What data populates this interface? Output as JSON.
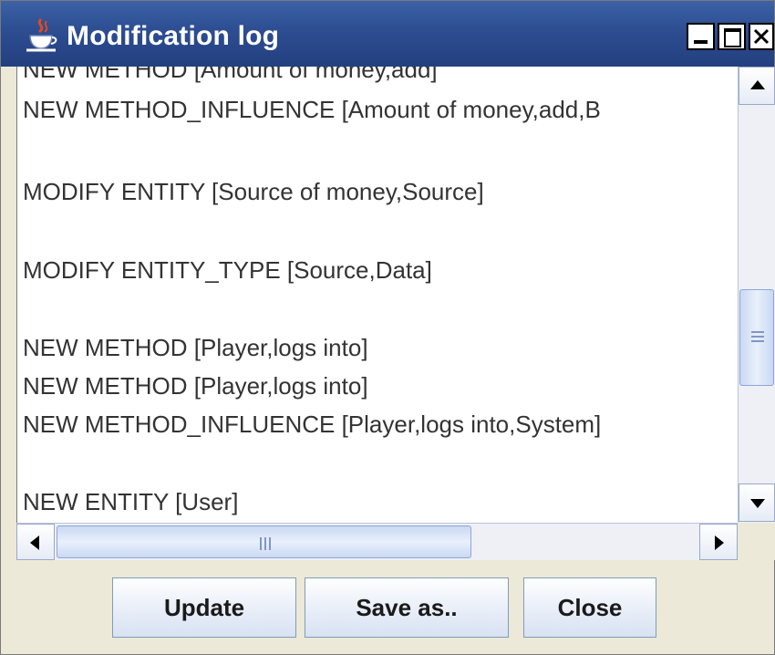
{
  "window": {
    "title": "Modification log",
    "controls": {
      "minimize": "minimize-icon",
      "maximize": "maximize-icon",
      "close": "close-icon"
    }
  },
  "log": {
    "lines": [
      "NEW METHOD [Amount of money,add]",
      "NEW METHOD_INFLUENCE [Amount of money,add,B",
      "",
      "MODIFY ENTITY [Source of money,Source]",
      "",
      "MODIFY ENTITY_TYPE [Source,Data]",
      "",
      "NEW METHOD [Player,logs into]",
      "NEW METHOD [Player,logs into]",
      "NEW METHOD_INFLUENCE [Player,logs into,System]",
      "",
      "NEW ENTITY [User]"
    ]
  },
  "buttons": {
    "update": "Update",
    "save_as": "Save as..",
    "close": "Close"
  },
  "colors": {
    "titlebar": "#2e4f93",
    "window_bg": "#ece9d8",
    "scroll_thumb": "#c9d8f2"
  }
}
